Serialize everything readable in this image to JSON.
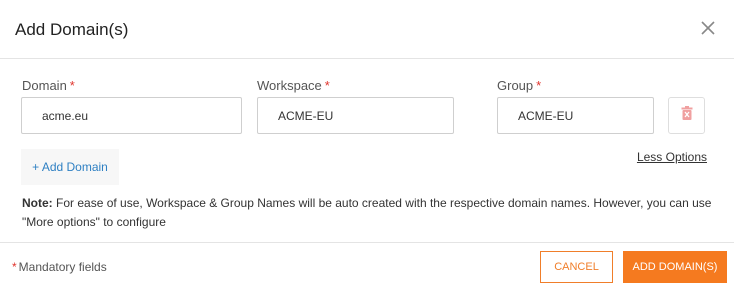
{
  "dialog": {
    "title": "Add Domain(s)",
    "close_icon": "close-icon"
  },
  "fields": {
    "domain": {
      "label": "Domain",
      "required_mark": "*",
      "value": "acme.eu"
    },
    "workspace": {
      "label": "Workspace",
      "required_mark": "*",
      "value": "ACME-EU"
    },
    "group": {
      "label": "Group",
      "required_mark": "*",
      "value": "ACME-EU"
    }
  },
  "row_actions": {
    "delete_icon": "trash-icon"
  },
  "actions": {
    "add_domain": "+ Add Domain",
    "less_options": "Less Options"
  },
  "note": {
    "label": "Note:",
    "text": "For ease of use, Workspace & Group Names will be auto created with the respective domain names. However, you can use \"More options\" to configure"
  },
  "footer": {
    "mandatory_mark": "*",
    "mandatory_text": "Mandatory fields",
    "cancel_label": "CANCEL",
    "submit_label": "ADD DOMAIN(S)"
  },
  "colors": {
    "accent": "#f57a1f",
    "required": "#e0342d",
    "link": "#2f80c3",
    "delete_icon": "#f0a0a0"
  }
}
